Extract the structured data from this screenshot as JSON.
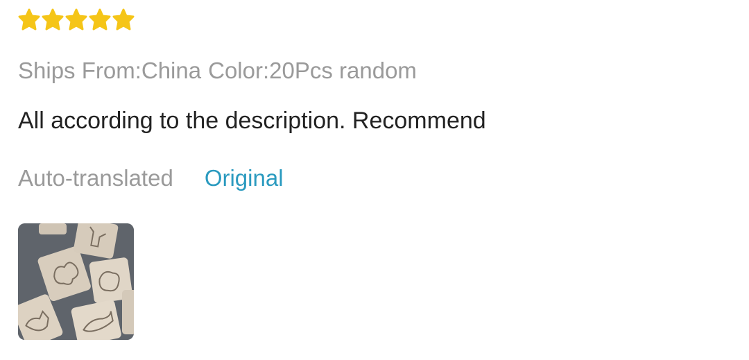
{
  "review": {
    "rating": 5,
    "rating_max": 5,
    "star_color": "#f5c518",
    "sku": {
      "ships_from": "Ships From:China",
      "color": "Color:20Pcs random"
    },
    "text": "All according to the description. Recommend",
    "translation": {
      "status_label": "Auto-translated",
      "toggle_label": "Original",
      "link_color": "#2a9abf"
    },
    "photos": [
      {
        "icon": "wooden-puzzle-cards-photo"
      }
    ]
  }
}
